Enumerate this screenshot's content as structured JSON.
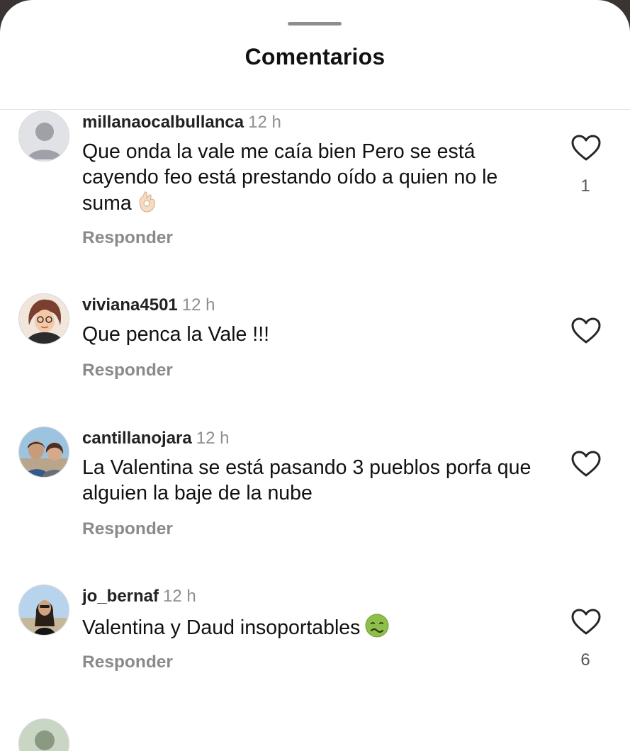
{
  "sheet": {
    "title": "Comentarios"
  },
  "comments": [
    {
      "username": "millanaocalbullanca",
      "time": "12 h",
      "text": "Que onda la vale me caía bien Pero se está cayendo feo está prestando oído a quien no le suma",
      "emoji": "ok-hand-emoji",
      "reply_label": "Responder",
      "like_count": "1"
    },
    {
      "username": "viviana4501",
      "time": "12 h",
      "text": "Que penca la Vale !!!",
      "reply_label": "Responder",
      "like_count": ""
    },
    {
      "username": "cantillanojara",
      "time": "12 h",
      "text": "La Valentina se está pasando 3 pueblos porfa que alguien la baje de la nube",
      "reply_label": "Responder",
      "like_count": ""
    },
    {
      "username": "jo_bernaf",
      "time": "12 h",
      "text": "Valentina y Daud insoportables",
      "emoji": "nauseated-face-emoji",
      "reply_label": "Responder",
      "like_count": "6"
    }
  ],
  "icons": {
    "like": "heart-outline-icon",
    "default_avatar": "default-avatar-icon"
  },
  "colors": {
    "text": "#111111",
    "secondary": "#8e8e8e",
    "background": "#ffffff"
  }
}
